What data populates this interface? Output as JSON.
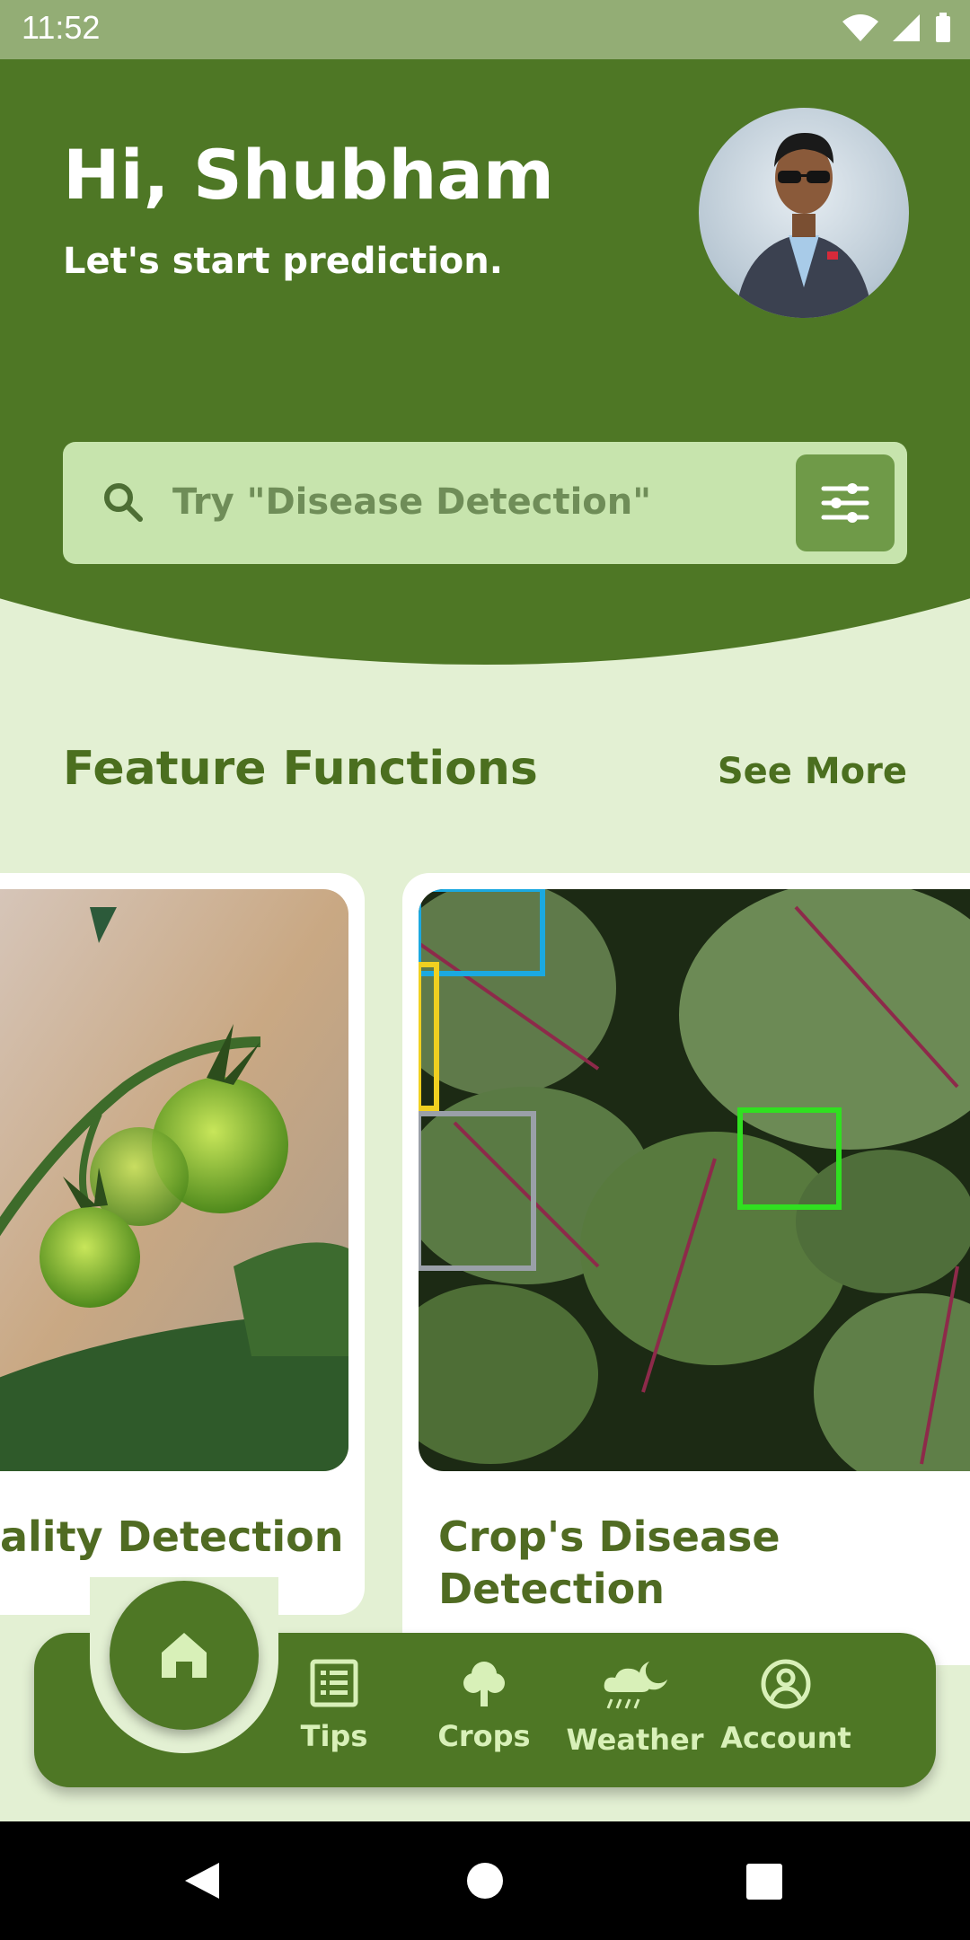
{
  "status_bar": {
    "time": "11:52"
  },
  "header": {
    "greeting": "Hi, Shubham",
    "subtitle": "Let's start prediction."
  },
  "search": {
    "placeholder": "Try \"Disease Detection\""
  },
  "features": {
    "title": "Feature Functions",
    "see_more": "See More",
    "cards": [
      {
        "label": "ality Detection"
      },
      {
        "label": "Crop's Disease Detection"
      }
    ]
  },
  "bottom_nav": {
    "items": [
      {
        "label": "Tips",
        "icon": "list-icon"
      },
      {
        "label": "Crops",
        "icon": "tree-icon"
      },
      {
        "label": "Weather",
        "icon": "weather-icon"
      },
      {
        "label": "Account",
        "icon": "account-icon"
      }
    ]
  },
  "colors": {
    "primary": "#4e7725",
    "background": "#e3f0d3",
    "search_bg": "#c7e4ad"
  }
}
